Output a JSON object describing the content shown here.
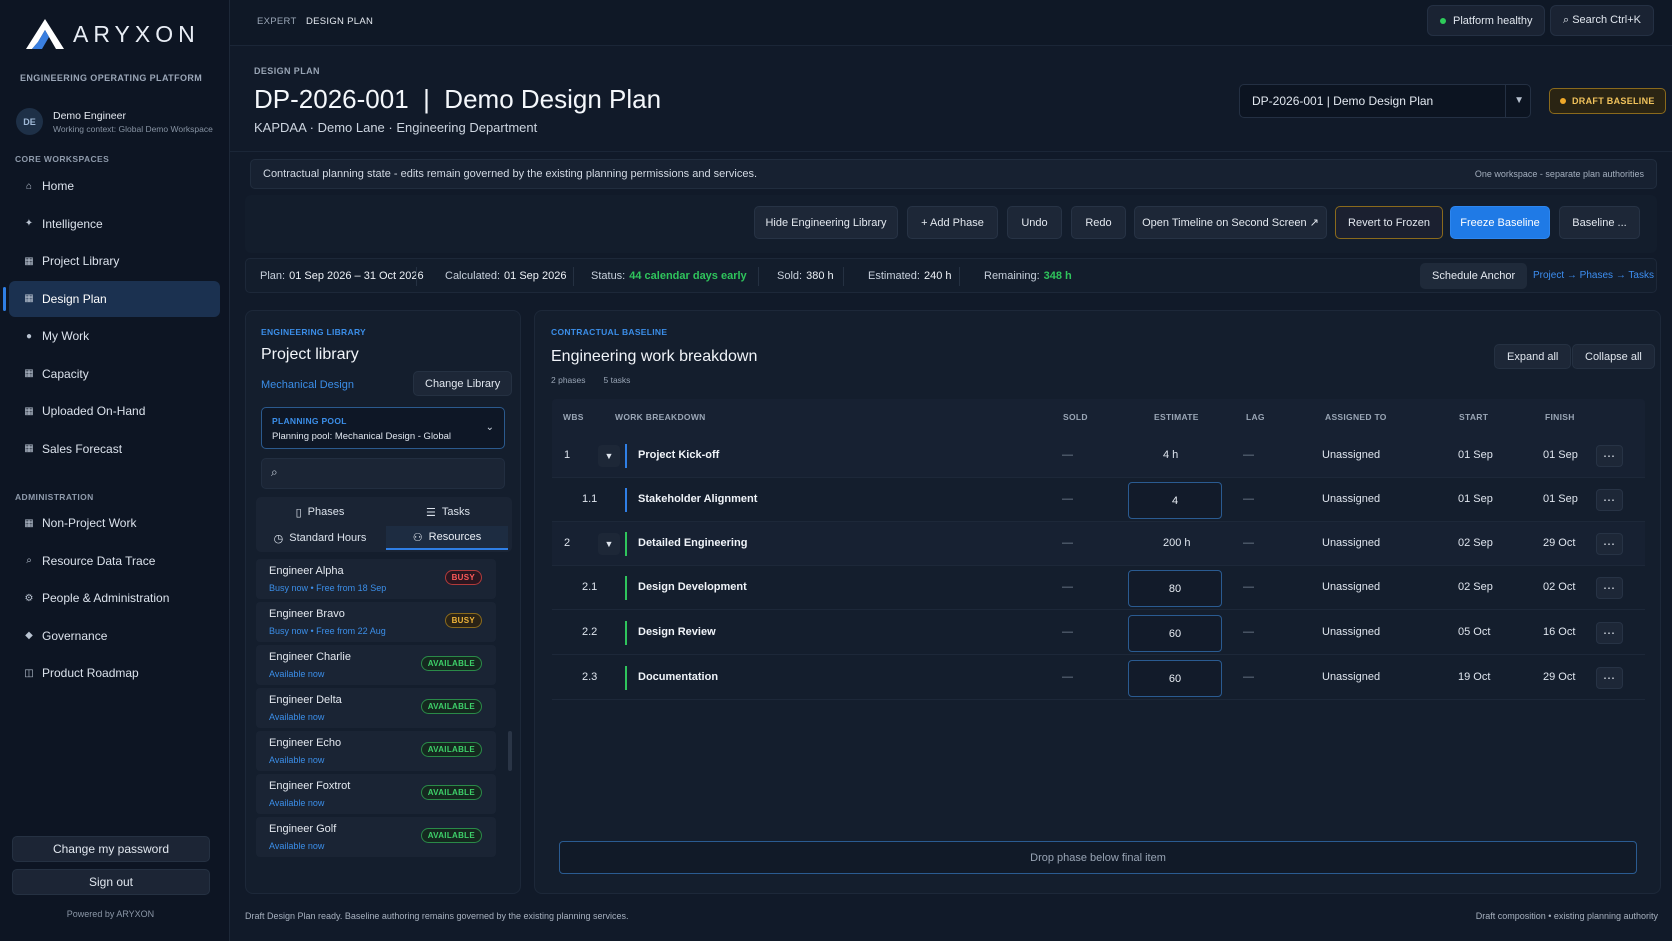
{
  "brand": {
    "name": "ARYXON",
    "platform": "ENGINEERING OPERATING PLATFORM",
    "powered": "Powered by ARYXON"
  },
  "user": {
    "initials": "DE",
    "name": "Demo Engineer",
    "context": "Working context: Global Demo Workspace"
  },
  "sidebar": {
    "core_title": "CORE WORKSPACES",
    "core": [
      {
        "label": "Home",
        "icon": "home-icon"
      },
      {
        "label": "Intelligence",
        "icon": "sparkle-icon"
      },
      {
        "label": "Project Library",
        "icon": "grid-icon"
      },
      {
        "label": "Design Plan",
        "icon": "grid-icon",
        "active": true
      },
      {
        "label": "My Work",
        "icon": "dot-icon"
      },
      {
        "label": "Capacity",
        "icon": "grid-icon"
      },
      {
        "label": "Uploaded On-Hand",
        "icon": "grid-icon"
      },
      {
        "label": "Sales Forecast",
        "icon": "grid-icon"
      }
    ],
    "admin_title": "ADMINISTRATION",
    "admin": [
      {
        "label": "Non-Project Work",
        "icon": "grid-icon"
      },
      {
        "label": "Resource Data Trace",
        "icon": "search-icon"
      },
      {
        "label": "People & Administration",
        "icon": "gear-icon"
      },
      {
        "label": "Governance",
        "icon": "diamond-icon"
      },
      {
        "label": "Product Roadmap",
        "icon": "map-icon"
      }
    ],
    "change_password": "Change my password",
    "sign_out": "Sign out"
  },
  "topbar": {
    "crumb_root": "EXPERT",
    "crumb_current": "DESIGN PLAN",
    "health": "Platform healthy",
    "search": "⌕ Search Ctrl+K"
  },
  "header": {
    "kicker": "DESIGN PLAN",
    "title": "DP-2026-001  |  Demo Design Plan",
    "subtitle": "KAPDAA  ·  Demo Lane  ·  Engineering Department",
    "plan_select": "DP-2026-001 | Demo Design Plan",
    "badge": "DRAFT BASELINE"
  },
  "notice": {
    "text": "Contractual planning state - edits remain governed by the existing planning permissions and services.",
    "right": "One workspace - separate plan authorities"
  },
  "toolbar": {
    "hide_library": "Hide Engineering Library",
    "add_phase": "+ Add Phase",
    "undo": "Undo",
    "redo": "Redo",
    "open_timeline": "Open Timeline on Second Screen ↗",
    "revert": "Revert to Frozen",
    "freeze": "Freeze Baseline",
    "baseline": "Baseline ..."
  },
  "stats": {
    "plan_label": "Plan:",
    "plan_value": "01 Sep 2026 – 31 Oct 2026",
    "calc_label": "Calculated:",
    "calc_value": "01 Sep 2026",
    "status_label": "Status:",
    "status_value": "44 calendar days early",
    "sold_label": "Sold:",
    "sold_value": "380 h",
    "est_label": "Estimated:",
    "est_value": "240 h",
    "rem_label": "Remaining:",
    "rem_value": "348 h",
    "anchor": "Schedule Anchor",
    "path": "Project → Phases → Tasks"
  },
  "library": {
    "kicker": "ENGINEERING LIBRARY",
    "title": "Project library",
    "discipline": "Mechanical Design",
    "change": "Change Library",
    "pool_label": "PLANNING POOL",
    "pool_value": "Planning pool: Mechanical Design - Global",
    "search_placeholder": "",
    "tabs": {
      "phases": "Phases",
      "tasks": "Tasks",
      "hours": "Standard Hours",
      "resources": "Resources"
    },
    "resources": [
      {
        "name": "Engineer Alpha",
        "sub": "Busy now • Free from 18 Sep",
        "badge": "BUSY",
        "kind": "busy-red"
      },
      {
        "name": "Engineer Bravo",
        "sub": "Busy now • Free from 22 Aug",
        "badge": "BUSY",
        "kind": "busy-amber"
      },
      {
        "name": "Engineer Charlie",
        "sub": "Available now",
        "badge": "AVAILABLE",
        "kind": "avail"
      },
      {
        "name": "Engineer Delta",
        "sub": "Available now",
        "badge": "AVAILABLE",
        "kind": "avail"
      },
      {
        "name": "Engineer Echo",
        "sub": "Available now",
        "badge": "AVAILABLE",
        "kind": "avail"
      },
      {
        "name": "Engineer Foxtrot",
        "sub": "Available now",
        "badge": "AVAILABLE",
        "kind": "avail"
      },
      {
        "name": "Engineer Golf",
        "sub": "Available now",
        "badge": "AVAILABLE",
        "kind": "avail"
      }
    ]
  },
  "wbs": {
    "kicker": "CONTRACTUAL BASELINE",
    "title": "Engineering work breakdown",
    "phases_count": "2 phases",
    "tasks_count": "5 tasks",
    "expand": "Expand all",
    "collapse": "Collapse all",
    "headers": {
      "wbs": "WBS",
      "work": "WORK BREAKDOWN",
      "sold": "SOLD",
      "estimate": "ESTIMATE",
      "lag": "LAG",
      "assigned": "ASSIGNED TO",
      "start": "START",
      "finish": "FINISH"
    },
    "rows": [
      {
        "wbs": "1",
        "name": "Project Kick-off",
        "sold": "—",
        "estimate": "4 h",
        "lag": "—",
        "assigned": "Unassigned",
        "start": "01 Sep",
        "finish": "01 Sep",
        "phase": true,
        "bar": "#2f7fe6"
      },
      {
        "wbs": "1.1",
        "name": "Stakeholder Alignment",
        "sold": "—",
        "estimate": "4",
        "lag": "—",
        "assigned": "Unassigned",
        "start": "01 Sep",
        "finish": "01 Sep",
        "phase": false,
        "bar": "#2f7fe6"
      },
      {
        "wbs": "2",
        "name": "Detailed Engineering",
        "sold": "—",
        "estimate": "200 h",
        "lag": "—",
        "assigned": "Unassigned",
        "start": "02 Sep",
        "finish": "29 Oct",
        "phase": true,
        "bar": "#2fc45c"
      },
      {
        "wbs": "2.1",
        "name": "Design Development",
        "sold": "—",
        "estimate": "80",
        "lag": "—",
        "assigned": "Unassigned",
        "start": "02 Sep",
        "finish": "02 Oct",
        "phase": false,
        "bar": "#2fc45c"
      },
      {
        "wbs": "2.2",
        "name": "Design Review",
        "sold": "—",
        "estimate": "60",
        "lag": "—",
        "assigned": "Unassigned",
        "start": "05 Oct",
        "finish": "16 Oct",
        "phase": false,
        "bar": "#2fc45c"
      },
      {
        "wbs": "2.3",
        "name": "Documentation",
        "sold": "—",
        "estimate": "60",
        "lag": "—",
        "assigned": "Unassigned",
        "start": "19 Oct",
        "finish": "29 Oct",
        "phase": false,
        "bar": "#2fc45c"
      }
    ],
    "dropzone": "Drop phase below final item"
  },
  "footer": {
    "left": "Draft Design Plan ready. Baseline authoring remains governed by the existing planning services.",
    "right": "Draft composition • existing planning authority"
  }
}
